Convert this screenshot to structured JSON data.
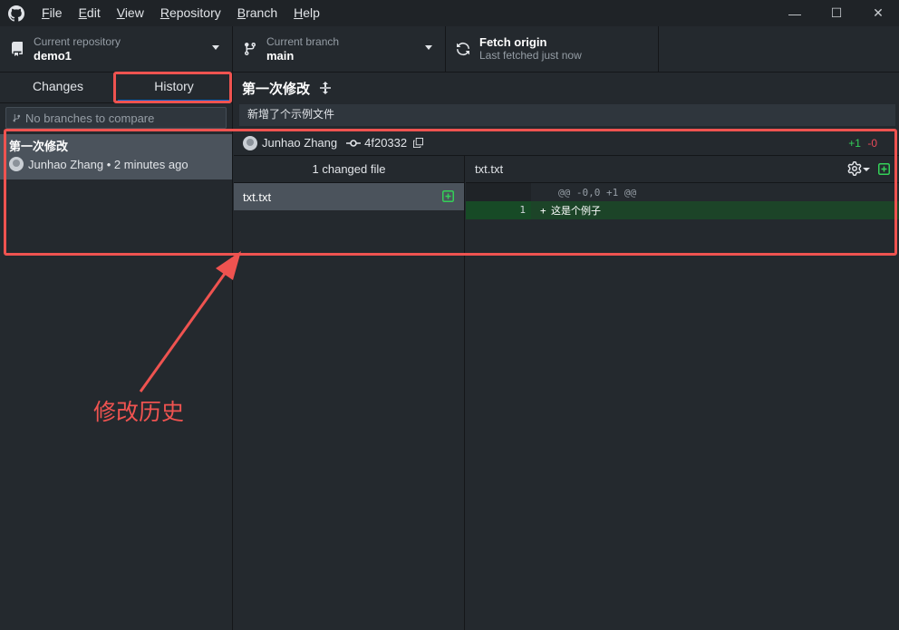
{
  "menu": {
    "items": [
      {
        "label_u": "F",
        "label_rest": "ile"
      },
      {
        "label_u": "E",
        "label_rest": "dit"
      },
      {
        "label_u": "V",
        "label_rest": "iew"
      },
      {
        "label_u": "R",
        "label_rest": "epository"
      },
      {
        "label_u": "B",
        "label_rest": "ranch"
      },
      {
        "label_u": "H",
        "label_rest": "elp"
      }
    ]
  },
  "window_controls": {
    "minimize": "—",
    "maximize": "☐",
    "close": "✕"
  },
  "toolbar": {
    "repo_label": "Current repository",
    "repo_value": "demo1",
    "branch_label": "Current branch",
    "branch_value": "main",
    "fetch_label": "Fetch origin",
    "fetch_sub": "Last fetched just now"
  },
  "sidebar": {
    "tabs": [
      {
        "label": "Changes",
        "active": false
      },
      {
        "label": "History",
        "active": true
      }
    ],
    "compare_placeholder": "No branches to compare",
    "commits": [
      {
        "title": "第一次修改",
        "author": "Junhao Zhang",
        "time": "2 minutes ago",
        "meta": "Junhao Zhang • 2 minutes ago"
      }
    ]
  },
  "commit": {
    "title": "第一次修改",
    "description": "新增了个示例文件",
    "author": "Junhao Zhang",
    "sha": "4f20332",
    "additions": "+1",
    "deletions": "-0"
  },
  "files": {
    "header": "1 changed file",
    "items": [
      {
        "name": "txt.txt",
        "status": "added"
      }
    ]
  },
  "diff": {
    "file": "txt.txt",
    "hunk": "@@ -0,0 +1 @@",
    "lines": [
      {
        "old": "",
        "new": "1",
        "sign": "+",
        "text": "这是个例子"
      }
    ]
  },
  "annotation": {
    "label": "修改历史",
    "color": "#ef5350"
  },
  "colors": {
    "accent": "#0366d6",
    "add": "#34d058",
    "delete": "#ea4a5a",
    "selected_row": "#4b535c"
  }
}
